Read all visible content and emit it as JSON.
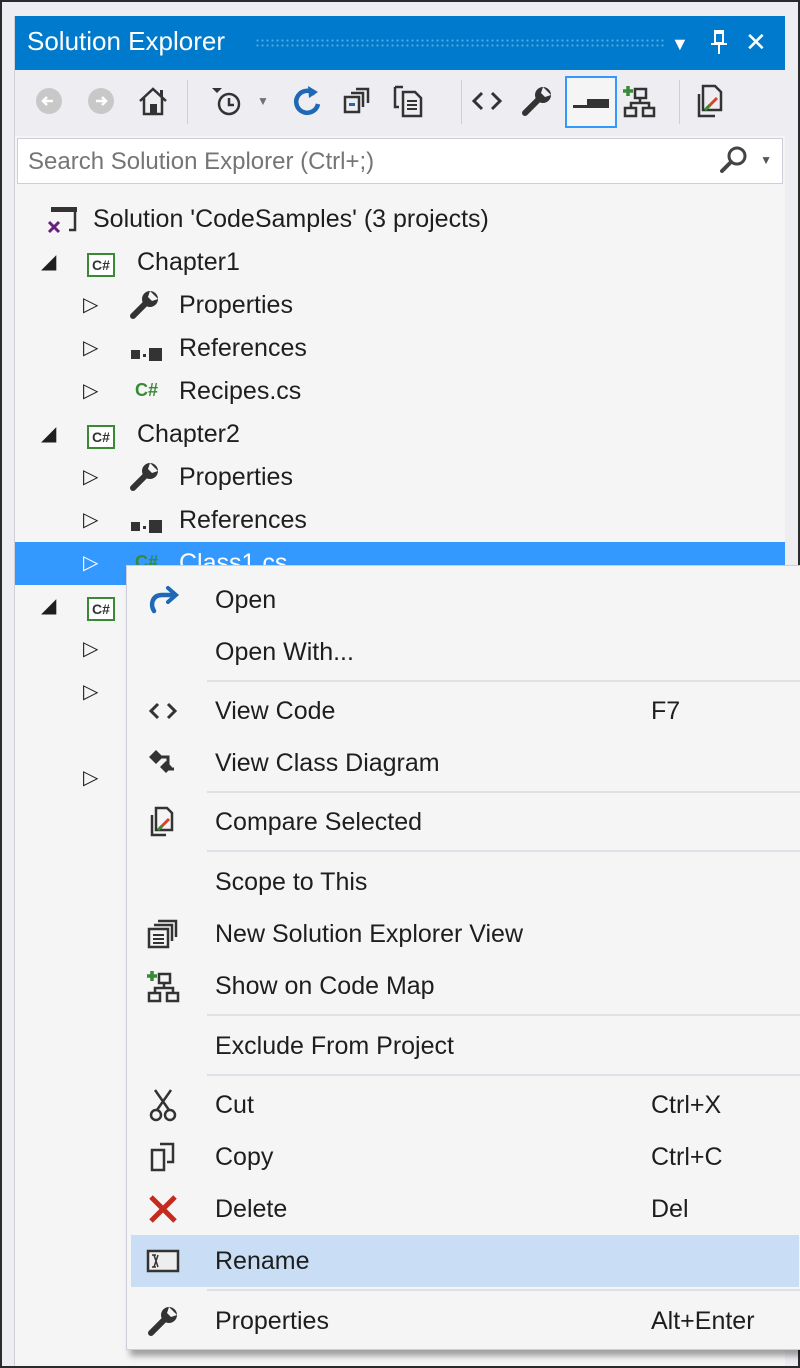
{
  "window": {
    "title": "Solution Explorer",
    "dropdown_icon": "chevron-down-icon",
    "pin_icon": "pin-icon",
    "close_icon": "close-icon"
  },
  "toolbar": {
    "buttons": [
      {
        "name": "back",
        "icon": "back-icon",
        "glyph": "⊖",
        "enabled": false
      },
      {
        "name": "forward",
        "icon": "forward-icon",
        "glyph": "⊕",
        "enabled": false
      },
      {
        "name": "home",
        "icon": "home-icon",
        "glyph": "⌂",
        "enabled": true
      },
      {
        "name": "pending-changes-filter",
        "icon": "clock-filter-icon",
        "glyph": "◷",
        "enabled": true
      },
      {
        "name": "sync",
        "icon": "refresh-icon",
        "glyph": "↻",
        "enabled": true
      },
      {
        "name": "collapse-all",
        "icon": "collapse-all-icon",
        "glyph": "❐",
        "enabled": true
      },
      {
        "name": "show-all-files",
        "icon": "show-all-files-icon",
        "glyph": "▤",
        "enabled": true
      },
      {
        "name": "view-code",
        "icon": "code-icon",
        "glyph": "‹›",
        "enabled": true
      },
      {
        "name": "properties",
        "icon": "wrench-icon",
        "glyph": "🔧",
        "enabled": true
      },
      {
        "name": "preview-selected",
        "icon": "preview-icon",
        "glyph": "▬",
        "enabled": true,
        "active": true
      },
      {
        "name": "show-on-code-map",
        "icon": "code-map-icon",
        "glyph": "⧉",
        "enabled": true
      },
      {
        "name": "compare",
        "icon": "compare-icon",
        "glyph": "⇄",
        "enabled": true
      }
    ]
  },
  "search": {
    "placeholder": "Search Solution Explorer (Ctrl+;)",
    "value": ""
  },
  "tree": {
    "solution": "Solution 'CodeSamples' (3 projects)",
    "items": [
      {
        "label": "Chapter1",
        "type": "project",
        "expanded": true
      },
      {
        "label": "Properties",
        "type": "properties"
      },
      {
        "label": "References",
        "type": "references"
      },
      {
        "label": "Recipes.cs",
        "type": "csfile"
      },
      {
        "label": "Chapter2",
        "type": "project",
        "expanded": true
      },
      {
        "label": "Properties",
        "type": "properties"
      },
      {
        "label": "References",
        "type": "references"
      },
      {
        "label": "Class1.cs",
        "type": "csfile",
        "selected": true
      }
    ]
  },
  "context_menu": {
    "items": [
      {
        "label": "Open",
        "icon": "open-arrow-icon",
        "shortcut": ""
      },
      {
        "label": "Open With...",
        "icon": "",
        "shortcut": ""
      },
      {
        "label": "View Code",
        "icon": "code-icon",
        "shortcut": "F7"
      },
      {
        "label": "View Class Diagram",
        "icon": "class-diagram-icon",
        "shortcut": ""
      },
      {
        "label": "Compare Selected",
        "icon": "compare-icon",
        "shortcut": ""
      },
      {
        "label": "Scope to This",
        "icon": "",
        "shortcut": ""
      },
      {
        "label": "New Solution Explorer View",
        "icon": "new-view-icon",
        "shortcut": ""
      },
      {
        "label": "Show on Code Map",
        "icon": "code-map-icon",
        "shortcut": ""
      },
      {
        "label": "Exclude From Project",
        "icon": "",
        "shortcut": ""
      },
      {
        "label": "Cut",
        "icon": "scissors-icon",
        "shortcut": "Ctrl+X"
      },
      {
        "label": "Copy",
        "icon": "copy-icon",
        "shortcut": "Ctrl+C"
      },
      {
        "label": "Delete",
        "icon": "delete-icon",
        "shortcut": "Del"
      },
      {
        "label": "Rename",
        "icon": "rename-icon",
        "shortcut": "",
        "highlighted": true
      },
      {
        "label": "Properties",
        "icon": "wrench-icon",
        "shortcut": "Alt+Enter"
      }
    ]
  },
  "colors": {
    "accent": "#007acc",
    "selection": "#3399ff",
    "menu_hover": "#c9def5",
    "csharp_green": "#388a34",
    "delete_red": "#c42b1c"
  }
}
